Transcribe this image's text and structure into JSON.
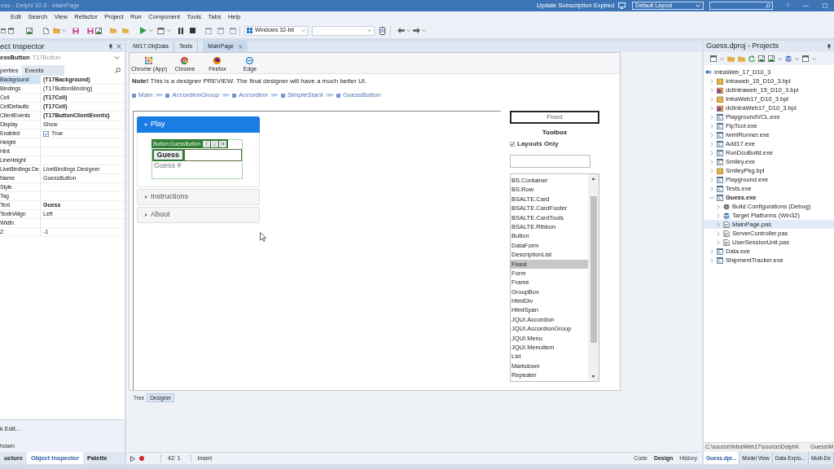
{
  "title_bar": {
    "title": "ess - Delphi 10.3 - MainPage",
    "notice": "Update Subscription Expired",
    "layout": "Default Layout",
    "help": "?"
  },
  "menu": [
    "Edit",
    "Search",
    "View",
    "Refactor",
    "Project",
    "Run",
    "Component",
    "Tools",
    "Tabs",
    "Help"
  ],
  "toolbar": {
    "platform": "Windows 32-bit"
  },
  "object_inspector": {
    "title": "ect Inspector",
    "component": "essButton",
    "component_type": "T17Button",
    "tabs": [
      {
        "label": "perties",
        "selected": true
      },
      {
        "label": "Events",
        "selected": false
      }
    ],
    "properties": [
      {
        "name": "Background",
        "kind": "text",
        "value": "(T17Background)",
        "bold": true,
        "selected": true
      },
      {
        "name": "Bindings",
        "kind": "text",
        "value": "(T17ButtonBinding)",
        "bold": false,
        "selected": false
      },
      {
        "name": "Cell",
        "kind": "text",
        "value": "(T17Cell)",
        "bold": true,
        "selected": false
      },
      {
        "name": "CellDefaults",
        "kind": "text",
        "value": "(T17Cell)",
        "bold": true,
        "selected": false
      },
      {
        "name": "ClientEvents",
        "kind": "text",
        "value": "(T17ButtonClientEvents)",
        "bold": true,
        "selected": false
      },
      {
        "name": "Display",
        "kind": "text",
        "value": "Show",
        "bold": false,
        "selected": false
      },
      {
        "name": "Enabled",
        "kind": "checkbox",
        "checked": true,
        "value": "True",
        "selected": false
      },
      {
        "name": "Height",
        "kind": "text",
        "selected": false
      },
      {
        "name": "Hint",
        "kind": "text",
        "selected": false
      },
      {
        "name": "LineHeight",
        "kind": "text",
        "selected": false
      },
      {
        "name": "LiveBindings De",
        "kind": "text",
        "value": "LiveBindings Designer",
        "bold": false,
        "selected": false
      },
      {
        "name": "Name",
        "kind": "text",
        "value": "GuessButton",
        "bold": false,
        "selected": false
      },
      {
        "name": "Style",
        "kind": "text",
        "selected": false
      },
      {
        "name": "Tag",
        "kind": "text",
        "selected": false
      },
      {
        "name": "Text",
        "kind": "text",
        "value": "Guess",
        "bold": true,
        "selected": false
      },
      {
        "name": "TextHAlign",
        "kind": "text",
        "value": "Left",
        "bold": false,
        "selected": false
      },
      {
        "name": "Width",
        "kind": "text",
        "selected": false
      },
      {
        "name": "Z",
        "kind": "text",
        "value": "-1",
        "bold": false,
        "selected": false
      }
    ],
    "quick_edit": "k Edit...",
    "filter": "hown",
    "bottom_tabs": [
      {
        "label": "ucture",
        "selected": false
      },
      {
        "label": "Object Inspector",
        "selected": true
      },
      {
        "label": "Palette",
        "selected": false
      }
    ]
  },
  "editor": {
    "tabs": [
      {
        "label": "IW17.ObjData",
        "selected": false
      },
      {
        "label": "Tests",
        "selected": false
      },
      {
        "label": "MainPage",
        "selected": true
      }
    ],
    "browsers": [
      {
        "label": "Chrome (App)",
        "kind": "apps"
      },
      {
        "label": "Chrome",
        "kind": "chrome"
      },
      {
        "label": "Firefox",
        "kind": "firefox"
      },
      {
        "label": "Edge",
        "kind": "edge"
      }
    ],
    "note": "**Note!** This is a designer PREVIEW. The final designer will have a much better UI.",
    "breadcrumb": {
      "separator": "⋙",
      "items": [
        {
          "label": "Main",
          "italic": false
        },
        {
          "label": "AccordionGroup",
          "italic": true
        },
        {
          "label": "Accordion",
          "italic": true
        },
        {
          "label": "SimpleStack",
          "italic": true
        },
        {
          "label": "GuessButton",
          "italic": false
        }
      ]
    },
    "accordion": [
      {
        "title": "Play",
        "expanded": true,
        "content": {
          "selection_label": "Button:GuessButton",
          "selection_buttons": [
            "↑",
            "↓",
            "×"
          ],
          "button": "Guess",
          "label": "Guess #"
        }
      },
      {
        "title": "Instructions",
        "expanded": false
      },
      {
        "title": "About",
        "expanded": false
      }
    ],
    "selected_component": "Fixed",
    "toolbox": {
      "title": "Toolbox",
      "layouts_only": {
        "label": "Layouts Only",
        "checked": true
      },
      "items": [
        {
          "label": "BS.Container",
          "selected": false
        },
        {
          "label": "BS.Row",
          "selected": false
        },
        {
          "label": "BSALTE.Card",
          "selected": false
        },
        {
          "label": "BSALTE.CardFooter",
          "selected": false
        },
        {
          "label": "BSALTE.CardTools",
          "selected": false
        },
        {
          "label": "BSALTE.Ribbon",
          "selected": false
        },
        {
          "label": "Button",
          "selected": false
        },
        {
          "label": "DataForm",
          "selected": false
        },
        {
          "label": "DescriptionList",
          "selected": false
        },
        {
          "label": "Fixed",
          "selected": true
        },
        {
          "label": "Form",
          "selected": false
        },
        {
          "label": "Frame",
          "selected": false
        },
        {
          "label": "GroupBox",
          "selected": false
        },
        {
          "label": "HtmlDiv",
          "selected": false
        },
        {
          "label": "HtmlSpan",
          "selected": false
        },
        {
          "label": "JQUI.Accordion",
          "selected": false
        },
        {
          "label": "JQUI.AccordionGroup",
          "selected": false
        },
        {
          "label": "JQUI.Menu",
          "selected": false
        },
        {
          "label": "JQUI.MenuItem",
          "selected": false
        },
        {
          "label": "List",
          "selected": false
        },
        {
          "label": "Markdown",
          "selected": false
        },
        {
          "label": "Repeater",
          "selected": false
        }
      ]
    },
    "view_tabs": [
      {
        "label": "Tree",
        "selected": false
      },
      {
        "label": "Designer",
        "selected": true
      }
    ]
  },
  "status_bar": {
    "position": "42: 1",
    "mode": "Insert",
    "tabs": [
      {
        "label": "Code",
        "selected": false
      },
      {
        "label": "Design",
        "selected": true
      },
      {
        "label": "History",
        "selected": false
      }
    ]
  },
  "projects": {
    "title": "Guess.dproj - Projects",
    "tree": {
      "label": "IntraWeb_17_D10_3",
      "children": [
        {
          "label": "Intraweb_15_D10_3.bpl",
          "kind": "bpl",
          "expanded": false,
          "selected": false,
          "active": false
        },
        {
          "label": "dclIntraweb_15_D10_3.bpl",
          "kind": "dcl",
          "expanded": false,
          "selected": false,
          "active": false
        },
        {
          "label": "IntraWeb17_D10_3.bpl",
          "kind": "bpl",
          "expanded": false,
          "selected": false,
          "active": false
        },
        {
          "label": "dclIntraWeb17_D10_3.bpl",
          "kind": "dcl",
          "expanded": false,
          "selected": false,
          "active": false
        },
        {
          "label": "PlaygroundVCL.exe",
          "kind": "exe",
          "expanded": false,
          "selected": false,
          "active": false
        },
        {
          "label": "FtpTool.exe",
          "kind": "exe",
          "expanded": false,
          "selected": false,
          "active": false
        },
        {
          "label": "IwmlRunner.exe",
          "kind": "exe",
          "expanded": false,
          "selected": false,
          "active": false
        },
        {
          "label": "Add17.exe",
          "kind": "exe",
          "expanded": false,
          "selected": false,
          "active": false
        },
        {
          "label": "RunDcuBuild.exe",
          "kind": "exe",
          "expanded": false,
          "selected": false,
          "active": false
        },
        {
          "label": "Smiley.exe",
          "kind": "exe",
          "expanded": false,
          "selected": false,
          "active": false
        },
        {
          "label": "SmileyPkg.bpl",
          "kind": "bpl",
          "expanded": false,
          "selected": false,
          "active": false
        },
        {
          "label": "Playground.exe",
          "kind": "exe",
          "expanded": false,
          "selected": false,
          "active": false
        },
        {
          "label": "Tests.exe",
          "kind": "exe",
          "expanded": false,
          "selected": false,
          "active": false
        },
        {
          "label": "Guess.exe",
          "kind": "exe",
          "expanded": true,
          "selected": false,
          "active": true,
          "children": [
            {
              "label": "Build Configurations (Debug)",
              "kind": "config",
              "expanded": false,
              "selected": false
            },
            {
              "label": "Target Platforms (Win32)",
              "kind": "platforms",
              "expanded": false,
              "selected": false
            },
            {
              "label": "MainPage.pas",
              "kind": "unit",
              "expanded": false,
              "selected": true
            },
            {
              "label": "ServerController.pas",
              "kind": "unit",
              "expanded": false,
              "selected": false
            },
            {
              "label": "UserSessionUnit.pas",
              "kind": "unit",
              "expanded": false,
              "selected": false
            }
          ]
        },
        {
          "label": "Data.exe",
          "kind": "exe",
          "expanded": false,
          "selected": false,
          "active": false
        },
        {
          "label": "ShipmentTracker.exe",
          "kind": "exe",
          "expanded": false,
          "selected": false,
          "active": false
        }
      ]
    },
    "path": [
      "C:\\source\\IntraWeb17\\source\\Delphi\\",
      "Guess\\M"
    ],
    "tabs": [
      {
        "label": "Guess.dpr...",
        "selected": true
      },
      {
        "label": "Model View",
        "selected": false
      },
      {
        "label": "Data Explo...",
        "selected": false
      },
      {
        "label": "Multi-De",
        "selected": false
      }
    ]
  }
}
